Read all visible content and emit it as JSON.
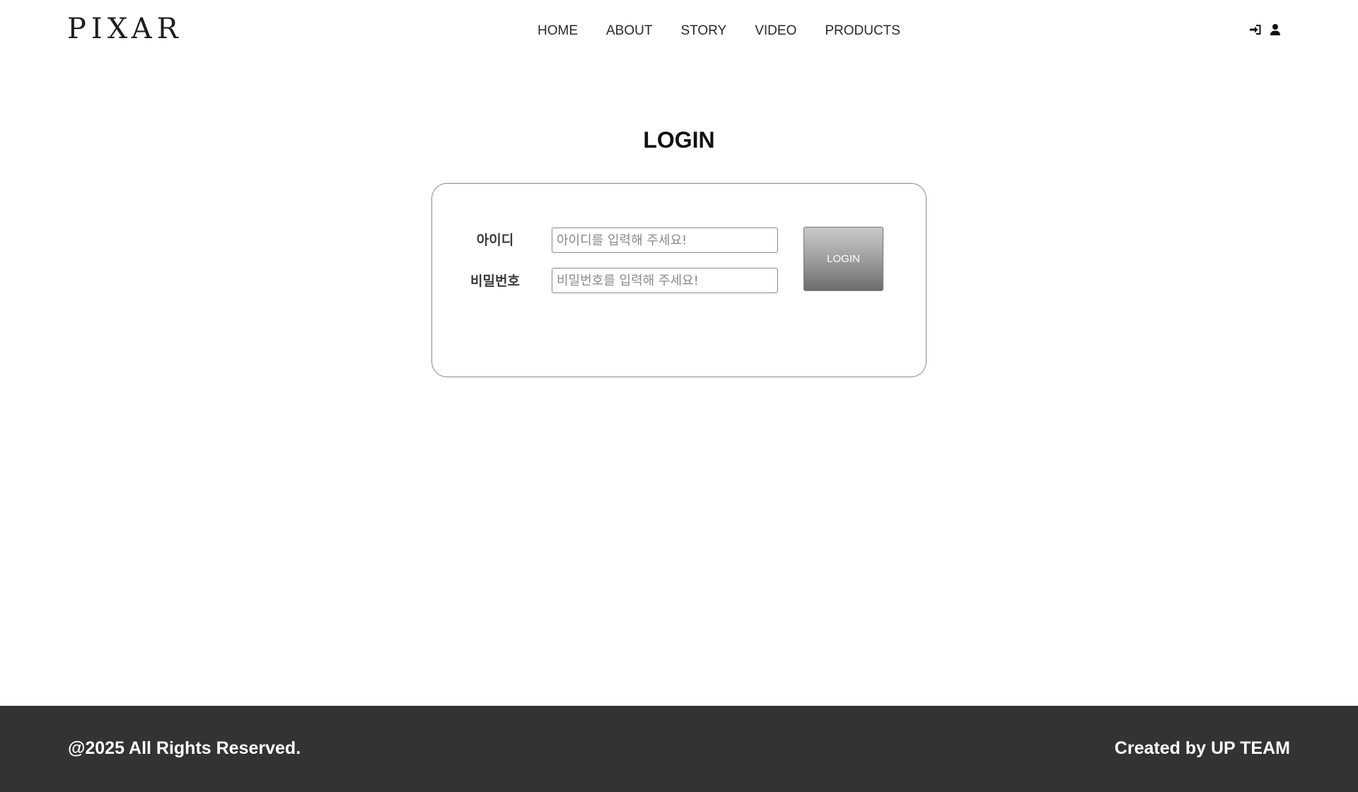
{
  "header": {
    "logo": "PIXAR",
    "nav": [
      {
        "label": "HOME"
      },
      {
        "label": "ABOUT"
      },
      {
        "label": "STORY"
      },
      {
        "label": "VIDEO"
      },
      {
        "label": "PRODUCTS"
      }
    ],
    "icons": [
      "login-icon",
      "user-icon"
    ]
  },
  "main": {
    "title": "LOGIN",
    "form": {
      "id_label": "아이디",
      "id_placeholder": "아이디를 입력해 주세요!",
      "id_value": "",
      "pw_label": "비밀번호",
      "pw_placeholder": "비밀번호를 입력해 주세요!",
      "pw_value": "",
      "submit_label": "LOGIN"
    }
  },
  "footer": {
    "copyright": "@2025 All Rights Reserved.",
    "credit": "Created by UP TEAM"
  },
  "colors": {
    "footer_bg": "#333333",
    "text": "#222222",
    "button_gradient_top": "#c9c9c9",
    "button_gradient_bottom": "#6d6d6d"
  }
}
